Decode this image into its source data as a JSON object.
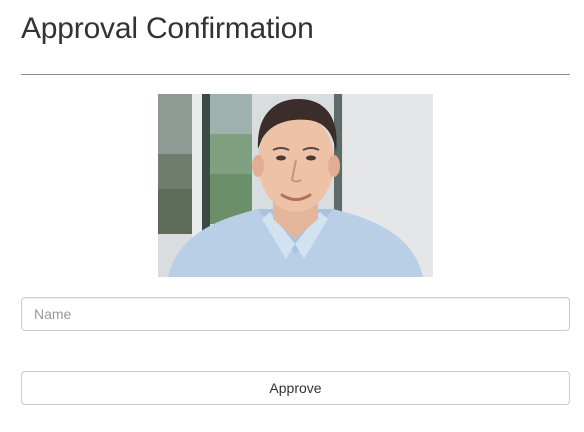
{
  "page": {
    "title": "Approval Confirmation"
  },
  "photo": {
    "alt": "Portrait photo of a smiling man in a light blue shirt"
  },
  "form": {
    "name_placeholder": "Name",
    "name_value": "",
    "approve_label": "Approve"
  }
}
